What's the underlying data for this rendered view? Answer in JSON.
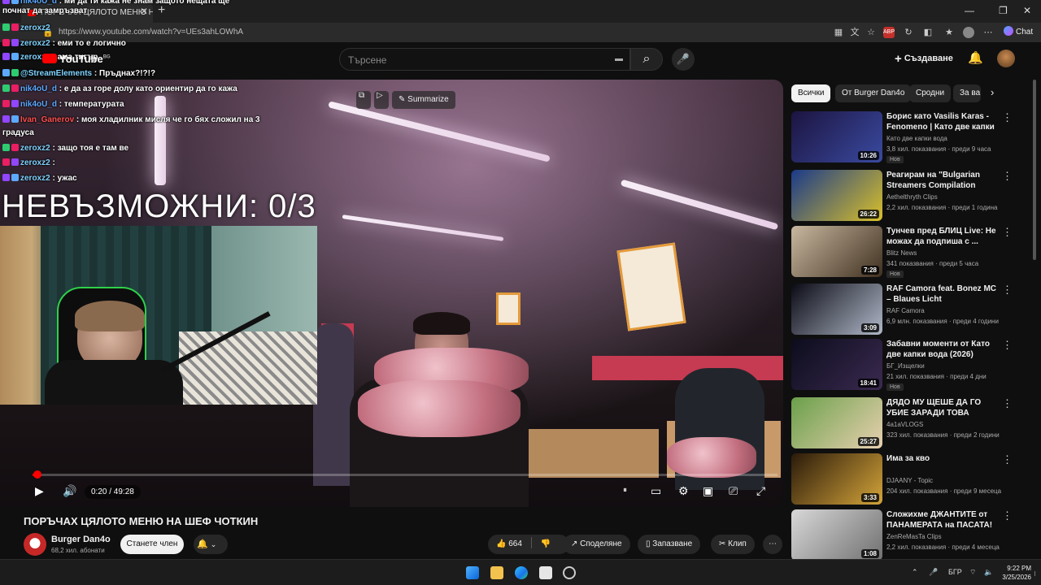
{
  "browser": {
    "tab_title": "ПОРЪЧАХ ЦЯЛОТО МЕНЮ НА Ш",
    "url": "https://www.youtube.com/watch?v=UEs3ahLOWhA",
    "chat_label": "Chat"
  },
  "header": {
    "logo": "YouTube",
    "region": "BG",
    "search_placeholder": "Търсене",
    "create_label": "Създаване"
  },
  "stream_overlay": {
    "chat": [
      {
        "user": "nik4oU_d",
        "text": ": ми да ти кажа не знам защото нещата ще"
      },
      {
        "user": "",
        "text": "почнат да замръзват"
      },
      {
        "user": "zeroxz2",
        "text": ""
      },
      {
        "user": "zeroxz2",
        "text": ": еми то е логично"
      },
      {
        "user": "zeroxz2",
        "text": ": ама тигър"
      },
      {
        "user": "@StreamElements",
        "text": ": Пръднах?!?!?"
      },
      {
        "user": "nik4oU_d",
        "text": ": е да аз горе долу като ориентир да го кажа"
      },
      {
        "user": "nik4oU_d",
        "text": ": температурата"
      },
      {
        "user": "Ivan_Ganerov",
        "text": ": моя хладилник мисля че го бях сложил на 3"
      },
      {
        "user": "",
        "text": "градуса"
      },
      {
        "user": "zeroxz2",
        "text": ": защо тоя е там ве"
      },
      {
        "user": "zeroxz2",
        "text": ":"
      },
      {
        "user": "zeroxz2",
        "text": ": ужас"
      }
    ],
    "challenge_text": "НЕВЪЗМОЖНИ: 0/3",
    "summarize_label": "Summarize"
  },
  "player": {
    "time": "0:20 / 49:28",
    "progress_fraction": 0.0067
  },
  "video": {
    "title": "ПОРЪЧАХ ЦЯЛОТО МЕНЮ НА ШЕФ ЧОТКИН",
    "channel": "Burger Dan4o",
    "subscribers": "68,2 хил. абонати",
    "join_label": "Станете член",
    "likes": "664",
    "share_label": "Споделяне",
    "save_label": "Запазване",
    "clip_label": "Клип"
  },
  "sidebar": {
    "chips": [
      "Всички",
      "От Burger Dan4o",
      "Сродни",
      "За ва"
    ],
    "recommendations": [
      {
        "title": "Борис като Vasilis Karas - Fenomeno | Като две капки ...",
        "channel": "Като две капки вода",
        "meta": "3,8 хил. показвания · преди 9 часа",
        "badge": "Нов",
        "duration": "10:26",
        "thumb_colors": [
          "#1c1440",
          "#3a4aa0"
        ]
      },
      {
        "title": "Реагирам на \"Bulgarian Streamers Compilation Reborn...",
        "channel": "Aethelthryth Clips",
        "meta": "2,2 хил. показвания · преди 1 година",
        "badge": "",
        "duration": "26:22",
        "thumb_colors": [
          "#1a3a8a",
          "#d9c02a"
        ]
      },
      {
        "title": "Тунчев пред БЛИЦ Live: Не можах да подпиша с ...",
        "channel": "Blitz News",
        "meta": "341 показвания · преди 5 часа",
        "badge": "Нов",
        "duration": "7:28",
        "thumb_colors": [
          "#c8b8a0",
          "#403020"
        ]
      },
      {
        "title": "RAF Camora feat. Bonez MC – Blaues Licht",
        "channel": "RAF Camora",
        "meta": "6,9 млн. показвания · преди 4 години",
        "badge": "",
        "duration": "3:09",
        "thumb_colors": [
          "#0a0a14",
          "#b0b8c8"
        ]
      },
      {
        "title": "Забавни моменти от Като две капки вода (2026)",
        "channel": "БГ_Изщелки",
        "meta": "21 хил. показвания · преди 4 дни",
        "badge": "Нов",
        "duration": "18:41",
        "thumb_colors": [
          "#0c0c1c",
          "#3a2a50"
        ]
      },
      {
        "title": "ДЯДО МУ ЩЕШЕ ДА ГО УБИЕ ЗАРАДИ ТОВА",
        "channel": "4a1aVLOGS",
        "meta": "323 хил. показвания · преди 2 години",
        "badge": "",
        "duration": "25:27",
        "thumb_colors": [
          "#6aa04a",
          "#e8d0b0"
        ]
      },
      {
        "title": "Има за кво",
        "channel": "DJAANY - Topic",
        "meta": "204 хил. показвания · преди 9 месеца",
        "badge": "",
        "duration": "3:33",
        "thumb_colors": [
          "#2a1a0a",
          "#d4a43a"
        ]
      },
      {
        "title": "Сложихме ДЖАНТИТЕ от ПАНАМЕРАТА на ПАСАТА!",
        "channel": "ZenReMasTa Clips",
        "meta": "2,2 хил. показвания · преди 4 месеца",
        "badge": "",
        "duration": "1:08",
        "thumb_colors": [
          "#d8d8d8",
          "#707070"
        ]
      }
    ]
  },
  "taskbar": {
    "lang": "БГР",
    "time": "9:22 PM",
    "date": "3/25/2026"
  }
}
